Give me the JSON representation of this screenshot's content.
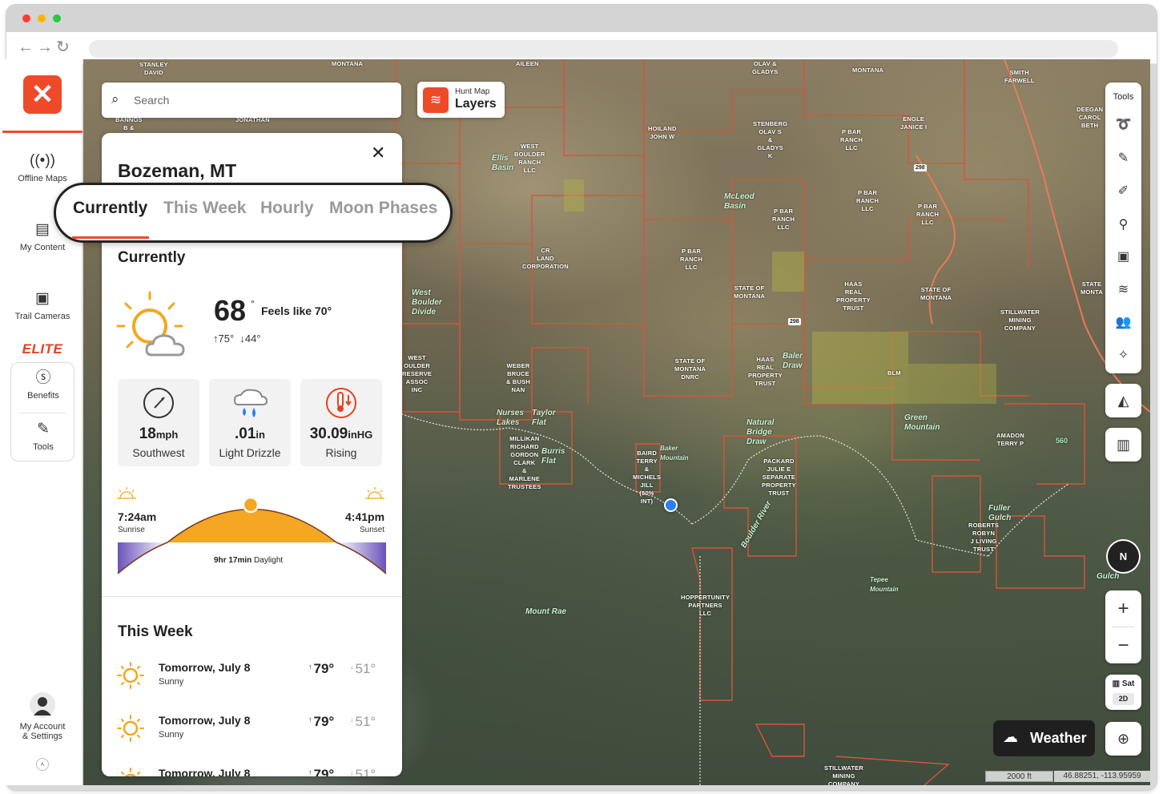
{
  "sidebar": {
    "items": [
      {
        "label": "Offline Maps",
        "icon": "offline-maps-icon"
      },
      {
        "label": "My Content",
        "icon": "my-content-icon"
      },
      {
        "label": "Trail Cameras",
        "icon": "trail-camera-icon"
      }
    ],
    "elite_label": "ELITE",
    "benefits_label": "Benefits",
    "tools_label": "Tools",
    "account_label_1": "My Account",
    "account_label_2": "& Settings"
  },
  "search": {
    "placeholder": "Search"
  },
  "layers_button": {
    "small": "Hunt Map",
    "big": "Layers"
  },
  "panel": {
    "title": "Bozeman, MT",
    "tabs": [
      "Currently",
      "This Week",
      "Hourly",
      "Moon Phases"
    ],
    "active_tab": "Currently",
    "currently": {
      "heading": "Currently",
      "temp": "68",
      "temp_unit": "°",
      "feels_like": "Feels like 70°",
      "high": "75°",
      "low": "44°",
      "stats": [
        {
          "value": "18",
          "unit": "mph",
          "label": "Southwest",
          "icon": "wind-gauge-icon"
        },
        {
          "value": ".01",
          "unit": "in",
          "label": "Light Drizzle",
          "icon": "rain-drops-icon"
        },
        {
          "value": "30.09",
          "unit": "inHG",
          "label": "Rising",
          "icon": "barometer-icon"
        }
      ],
      "sunrise_time": "7:24am",
      "sunrise_label": "Sunrise",
      "sunset_time": "4:41pm",
      "sunset_label": "Sunset",
      "daylight_value": "9hr 17min",
      "daylight_label": "Daylight"
    },
    "this_week": {
      "heading": "This Week",
      "days": [
        {
          "day": "Tomorrow, July 8",
          "condition": "Sunny",
          "high": "79°",
          "low": "51°"
        },
        {
          "day": "Tomorrow, July 8",
          "condition": "Sunny",
          "high": "79°",
          "low": "51°"
        },
        {
          "day": "Tomorrow, July 8",
          "condition": "",
          "high": "79°",
          "low": "51°"
        }
      ]
    }
  },
  "right_tools": {
    "header": "Tools"
  },
  "map_controls": {
    "compass_label": "N",
    "zoom_in": "+",
    "zoom_out": "−",
    "basemap_label": "Sat",
    "view_mode": "2D",
    "weather_label": "Weather",
    "scale": "2000 ft",
    "coordinates": "46.88251, -113.95959"
  },
  "map_labels": {
    "owners": [
      "STANLEY\nDAVID",
      "MONTANA",
      "AILEEN",
      "OLAV &\nGLADYS",
      "MONTANA",
      "SMITH\nFARWELL",
      "DEEGAN\nCAROL\nBETH",
      "BANNOS\nB &",
      "JONATHAN",
      "HOILAND\nJOHN W",
      "STENBERG\nOLAV S\n&\nGLADYS\nK",
      "P BAR\nRANCH\nLLC",
      "ENGLE\nJANICE I",
      "WEST\nBOULDER\nRANCH\nLLC",
      "P BAR\nRANCH\nLLC",
      "P BAR\nRANCH\nLLC",
      "P BAR\nRANCH\nLLC",
      "CR\nLAND\nCORPORATION",
      "P BAR\nRANCH\nLLC",
      "STATE OF\nMONTANA",
      "HAAS\nREAL\nPROPERTY\nTRUST",
      "STATE OF\nMONTANA",
      "STATE\nMONTA",
      "STILLWATER\nMINING\nCOMPANY",
      "WEST\nOULDER\nRESERVE\nASSOC\nINC",
      "WEBER\nBRUCE\n& BUSH\nNAN",
      "STATE OF\nMONTANA\nDNRC",
      "HAAS\nREAL\nPROPERTY\nTRUST",
      "BLM",
      "MILLIKAN\nRICHARD\nGORDON\nCLARK\n&\nMARLENE\nTRUSTEES",
      "BAIRD\nTERRY\n&\nMICHELS\nJILL\n(50%\nINT)",
      "PACKARD\nJULIE E\nSEPARATE\nPROPERTY\nTRUST",
      "AMADON\nTERRY P",
      "ROBERTS\nROBYN\nJ LIVING\nTRUST",
      "HOPPERTUNITY\nPARTNERS\nLLC",
      "STILLWATER\nMINING\nCOMPANY"
    ],
    "places": [
      "Ellis\nBasin",
      "McLeod\nBasin",
      "West\nBoulder\nDivide",
      "Taylor\nFlat",
      "Nurses\nLakes",
      "Burris\nFlat",
      "Baker\nMountain",
      "Baler\nDraw",
      "Natural\nBridge\nDraw",
      "Green\nMountain",
      "Boulder River",
      "Mount Rae",
      "Tepee\nMountain",
      "Fuller\nGulch",
      "Gulch",
      "560"
    ],
    "roads": [
      "298",
      "298"
    ]
  }
}
